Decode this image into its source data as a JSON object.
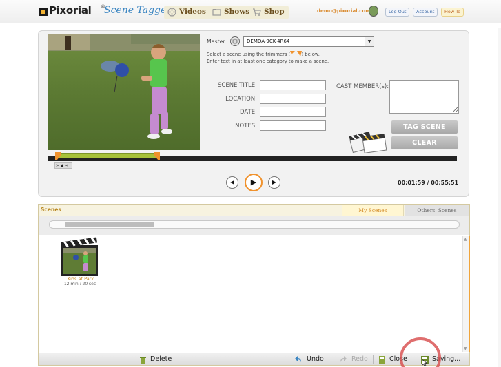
{
  "header": {
    "brand": "Pixorial",
    "brand_mark": "®",
    "product": "Scene Tagger",
    "nav": [
      {
        "label": "Videos"
      },
      {
        "label": "Shows"
      },
      {
        "label": "Shop"
      }
    ],
    "user_email": "demo@pixorial.com",
    "logout_label": "Log Out",
    "account_label": "Account",
    "howto_label": "How To"
  },
  "tagger": {
    "master_label": "Master:",
    "master_value": "DEMOA-9CK-4R64",
    "instruction_1a": "Select a scene using the trimmers (",
    "instruction_1b": ") below.",
    "instruction_2": "Enter text in at least one category to make a scene.",
    "fields": {
      "title_label": "SCENE TITLE:",
      "location_label": "LOCATION:",
      "date_label": "DATE:",
      "notes_label": "NOTES:",
      "title_value": "",
      "location_value": "",
      "date_value": "",
      "notes_value": ""
    },
    "cast_label": "CAST MEMBER(s):",
    "cast_value": "",
    "tag_button": "TAG SCENE",
    "clear_button": "CLEAR",
    "mini_controls": "> ▲ <",
    "time_display": "00:01:59 / 00:55:51",
    "selection_start_fraction": 0.017,
    "selection_end_fraction": 0.273
  },
  "scenes": {
    "title": "Scenes",
    "tabs": [
      {
        "label": "My Scenes",
        "active": true
      },
      {
        "label": "Others' Scenes",
        "active": false
      }
    ],
    "items": [
      {
        "name": "Kids at Park",
        "duration": "12 min : 20 sec"
      }
    ],
    "footer": {
      "delete_label": "Delete",
      "undo_label": "Undo",
      "redo_label": "Redo",
      "close_label": "Close",
      "save_label": "Saving..."
    }
  },
  "colors": {
    "accent_orange": "#f0922d",
    "brand_blue": "#3c86c2",
    "timeline_selection": "#a7c13a"
  }
}
